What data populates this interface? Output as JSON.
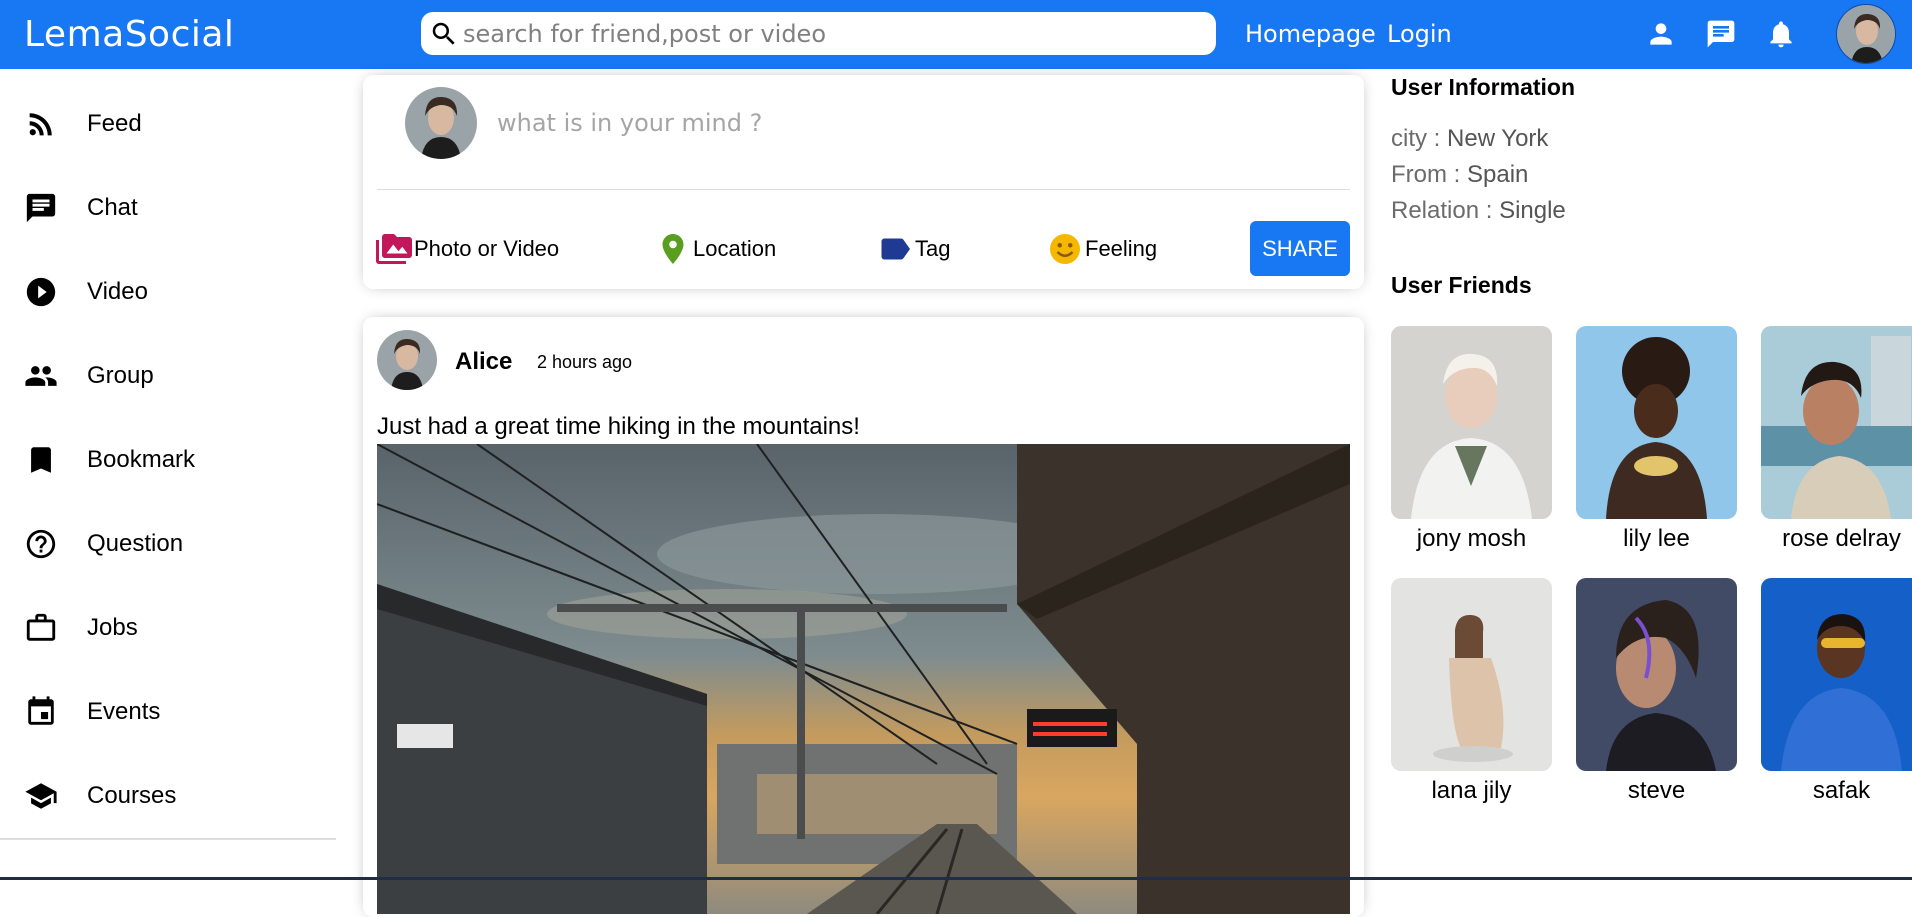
{
  "app": {
    "name": "LemaSocial"
  },
  "topbar": {
    "search_placeholder": "search for friend,post or video",
    "links": [
      "Homepage",
      "Login"
    ],
    "icons": [
      "person-icon",
      "chat-icon",
      "notification-icon"
    ]
  },
  "sidebar": {
    "items": [
      {
        "label": "Feed",
        "icon": "rss-feed-icon"
      },
      {
        "label": "Chat",
        "icon": "chat-icon"
      },
      {
        "label": "Video",
        "icon": "play-circle-icon"
      },
      {
        "label": "Group",
        "icon": "group-icon"
      },
      {
        "label": "Bookmark",
        "icon": "bookmark-icon"
      },
      {
        "label": "Question",
        "icon": "help-outline-icon"
      },
      {
        "label": "Jobs",
        "icon": "work-outline-icon"
      },
      {
        "label": "Events",
        "icon": "event-icon"
      },
      {
        "label": "Courses",
        "icon": "school-icon"
      }
    ]
  },
  "share": {
    "placeholder": "what is in your mind ?",
    "options": [
      {
        "label": "Photo or Video",
        "icon": "perm-media-icon",
        "color": "#c2185b"
      },
      {
        "label": "Location",
        "icon": "room-icon",
        "color": "#4caf50"
      },
      {
        "label": "Tag",
        "icon": "label-icon",
        "color": "#1f3a93"
      },
      {
        "label": "Feeling",
        "icon": "emoji-emotions-icon",
        "color": "#f5b800"
      }
    ],
    "button_label": "SHARE"
  },
  "post": {
    "username": "Alice",
    "time": "2 hours ago",
    "text": "Just had a great time hiking in the mountains!"
  },
  "right": {
    "info_title": "User Information",
    "info": [
      {
        "key": "city : ",
        "value": "New York"
      },
      {
        "key": "From : ",
        "value": "Spain"
      },
      {
        "key": "Relation : ",
        "value": "Single"
      }
    ],
    "friends_title": "User Friends",
    "friends": [
      "jony mosh",
      "lily lee",
      "rose delray",
      "lana jily",
      "steve",
      "safak"
    ]
  },
  "colors": {
    "primary": "#1877f2",
    "text": "#000000",
    "muted": "#6b6b6b"
  }
}
